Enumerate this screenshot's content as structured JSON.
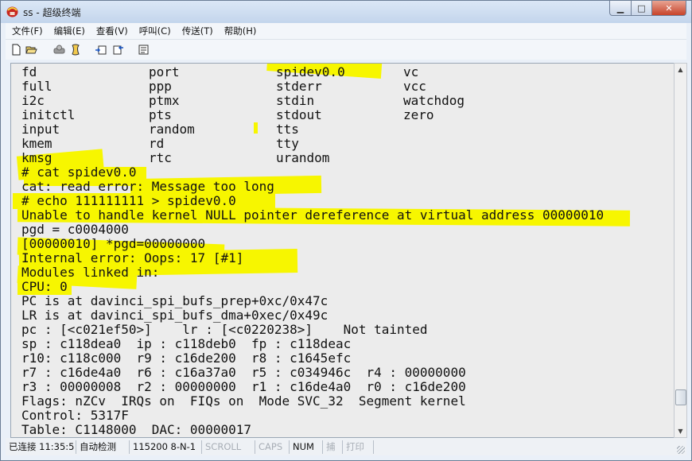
{
  "window": {
    "title": "ss - 超级终端",
    "app_icon": "hyperterminal-icon",
    "controls": [
      "minimize-icon",
      "maximize-icon",
      "close-icon"
    ]
  },
  "menu": {
    "items": [
      "文件(F)",
      "编辑(E)",
      "查看(V)",
      "呼叫(C)",
      "传送(T)",
      "帮助(H)"
    ]
  },
  "toolbar": {
    "buttons": [
      "new-icon",
      "open-icon",
      "disconnect-icon",
      "dial-icon",
      "send-icon",
      "receive-icon",
      "properties-icon"
    ]
  },
  "terminal": {
    "highlight_color": "#f7f600",
    "listing": [
      [
        "fd",
        "port",
        "spidev0.0",
        "vc"
      ],
      [
        "full",
        "ppp",
        "stderr",
        "vcc"
      ],
      [
        "i2c",
        "ptmx",
        "stdin",
        "watchdog"
      ],
      [
        "initctl",
        "pts",
        "stdout",
        "zero"
      ],
      [
        "input",
        "random",
        "tts",
        ""
      ],
      [
        "kmem",
        "rd",
        "tty",
        ""
      ],
      [
        "kmsg",
        "rtc",
        "urandom",
        ""
      ]
    ],
    "lines": [
      "# cat spidev0.0",
      "cat: read error: Message too long",
      "# echo 111111111 > spidev0.0",
      "Unable to handle kernel NULL pointer dereference at virtual address 00000010",
      "pgd = c0004000",
      "[00000010] *pgd=00000000",
      "Internal error: Oops: 17 [#1]",
      "Modules linked in:",
      "CPU: 0",
      "PC is at davinci_spi_bufs_prep+0xc/0x47c",
      "LR is at davinci_spi_bufs_dma+0xec/0x49c",
      "pc : [<c021ef50>]    lr : [<c0220238>]    Not tainted",
      "sp : c118dea0  ip : c118deb0  fp : c118deac",
      "r10: c118c000  r9 : c16de200  r8 : c1645efc",
      "r7 : c16de4a0  r6 : c16a37a0  r5 : c034946c  r4 : 00000000",
      "r3 : 00000008  r2 : 00000000  r1 : c16de4a0  r0 : c16de200",
      "Flags: nZCv  IRQs on  FIQs on  Mode SVC_32  Segment kernel",
      "Control: 5317F",
      "Table: C1148000  DAC: 00000017"
    ]
  },
  "statusbar": {
    "connection": "已连接 11:35:5",
    "detect": "自动检测",
    "settings": "115200 8-N-1",
    "scroll": "SCROLL",
    "caps": "CAPS",
    "num": "NUM",
    "capture": "捕",
    "print": "打印"
  }
}
